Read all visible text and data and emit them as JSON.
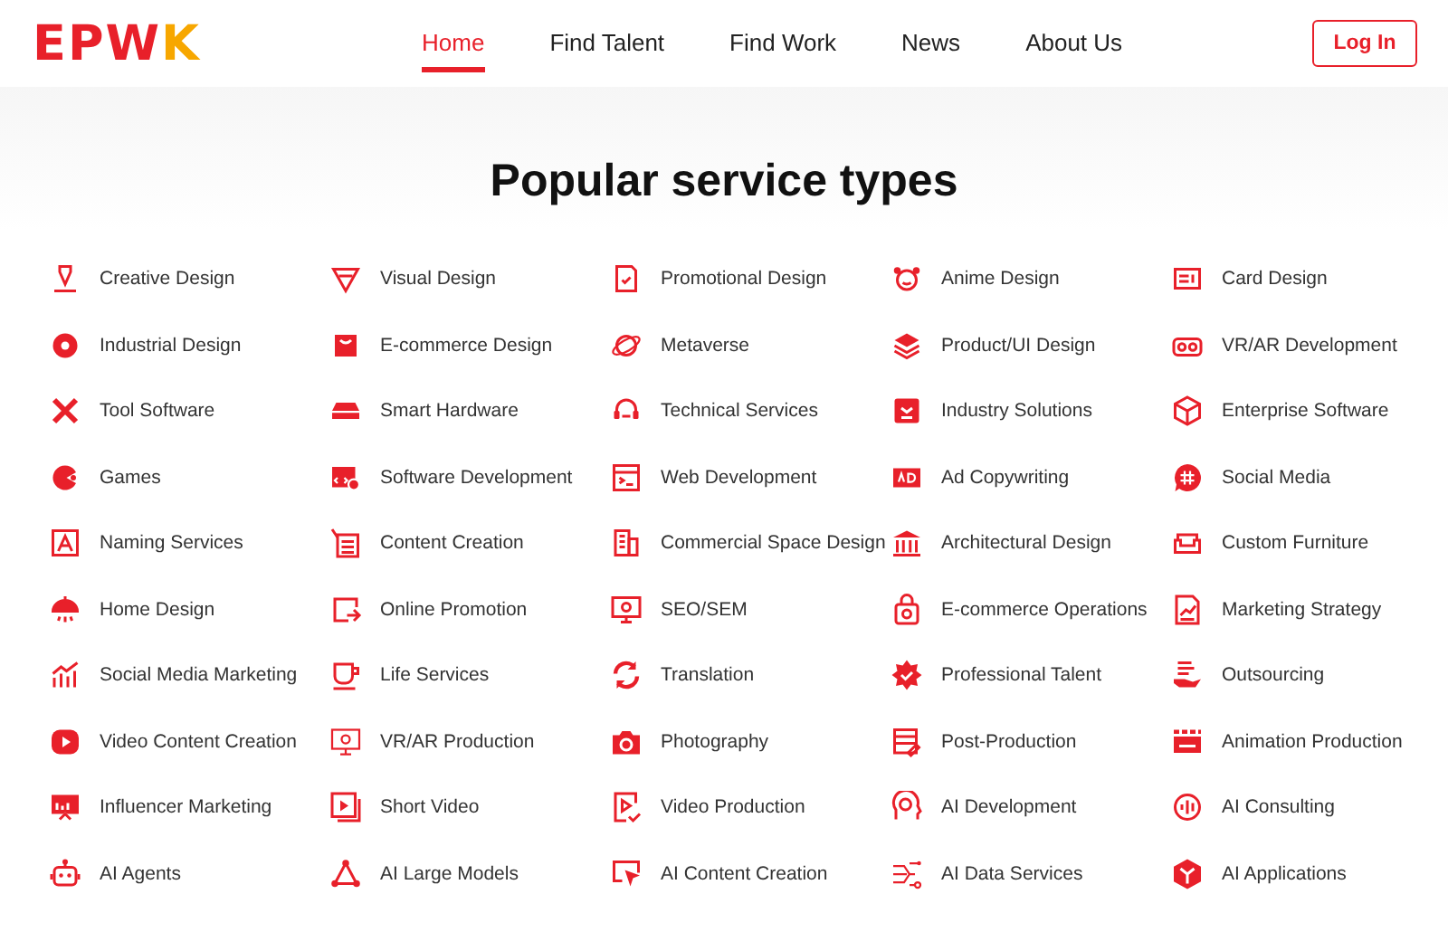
{
  "logo": {
    "text": "EPWK"
  },
  "nav": [
    {
      "label": "Home",
      "selected": true
    },
    {
      "label": "Find Talent",
      "selected": false
    },
    {
      "label": "Find Work",
      "selected": false
    },
    {
      "label": "News",
      "selected": false
    },
    {
      "label": "About Us",
      "selected": false
    }
  ],
  "login_button": "Log In",
  "title": "Popular service types",
  "services": [
    "Creative Design",
    "Visual Design",
    "Promotional Design",
    "Anime Design",
    "Card Design",
    "Industrial Design",
    "E-commerce Design",
    "Metaverse",
    "Product/UI Design",
    "VR/AR Development",
    "Tool Software",
    "Smart Hardware",
    "Technical Services",
    "Industry Solutions",
    "Enterprise Software",
    "Games",
    "Software Development",
    "Web Development",
    "Ad Copywriting",
    "Social Media",
    "Naming Services",
    "Content Creation",
    "Commercial Space Design",
    "Architectural Design",
    "Custom Furniture",
    "Home Design",
    "Online Promotion",
    "SEO/SEM",
    "E-commerce Operations",
    "Marketing Strategy",
    "Social Media Marketing",
    "Life Services",
    "Translation",
    "Professional Talent",
    "Outsourcing",
    "Video Content Creation",
    "VR/AR Production",
    "Photography",
    "Post-Production",
    "Animation Production",
    "Influencer Marketing",
    "Short Video",
    "Video Production",
    "AI Development",
    "AI Consulting",
    "AI Agents",
    "AI Large Models",
    "AI Content Creation",
    "AI Data Services",
    "AI Applications"
  ]
}
